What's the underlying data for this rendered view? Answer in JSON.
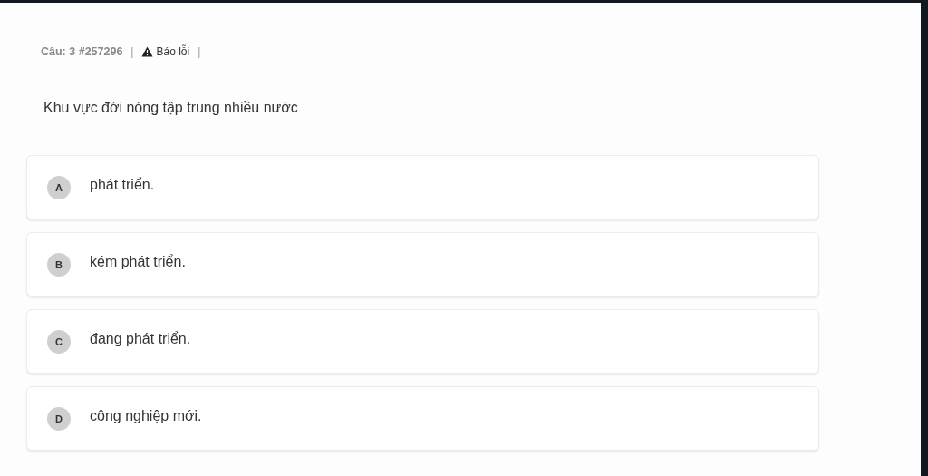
{
  "header": {
    "question_label": "Câu: 3 #257296",
    "separator_1": "|",
    "report_link": "Báo lỗi",
    "separator_2": "|"
  },
  "question": "Khu vực đới nóng tập trung nhiều nước",
  "options": [
    {
      "letter": "A",
      "text": "phát triển."
    },
    {
      "letter": "B",
      "text": "kém phát triển."
    },
    {
      "letter": "C",
      "text": "đang phát triển."
    },
    {
      "letter": "D",
      "text": "công nghiệp mới."
    }
  ]
}
